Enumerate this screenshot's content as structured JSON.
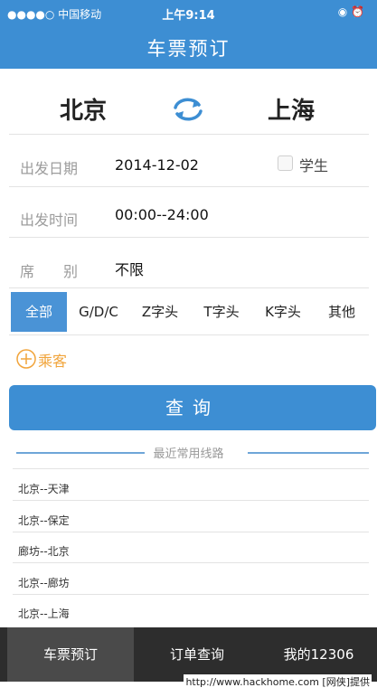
{
  "status_bar": {
    "carrier": "●●●●○ 中国移动",
    "time": "上午9:14",
    "indicators": "◉ ⏰"
  },
  "header": {
    "title": "车票预订"
  },
  "route": {
    "from": "北京",
    "to": "上海",
    "swap_icon": "swap-arrows-icon"
  },
  "form": {
    "date_label": "出发日期",
    "date_value": "2014-12-02",
    "student_label": "学生",
    "time_label": "出发时间",
    "time_value": "00:00--24:00",
    "seat_label": "席　　别",
    "seat_value": "不限"
  },
  "train_types": [
    {
      "label": "全部",
      "active": true
    },
    {
      "label": "G/D/C",
      "active": false
    },
    {
      "label": "Z字头",
      "active": false
    },
    {
      "label": "T字头",
      "active": false
    },
    {
      "label": "K字头",
      "active": false
    },
    {
      "label": "其他",
      "active": false
    }
  ],
  "passenger": {
    "label": "乘客"
  },
  "search_button": "查询",
  "recent": {
    "title": "最近常用线路",
    "routes": [
      "北京--天津",
      "北京--保定",
      "廊坊--北京",
      "北京--廊坊",
      "北京--上海"
    ]
  },
  "bottom_tabs": [
    {
      "label": "车票预订",
      "active": true
    },
    {
      "label": "订单查询",
      "active": false
    },
    {
      "label": "我的12306",
      "active": false
    }
  ],
  "watermark": "http://www.hackhome.com [网侠]提供",
  "colors": {
    "primary": "#3d8ed3",
    "accent": "#f1a43b",
    "tabbar": "#2d2d2d"
  }
}
